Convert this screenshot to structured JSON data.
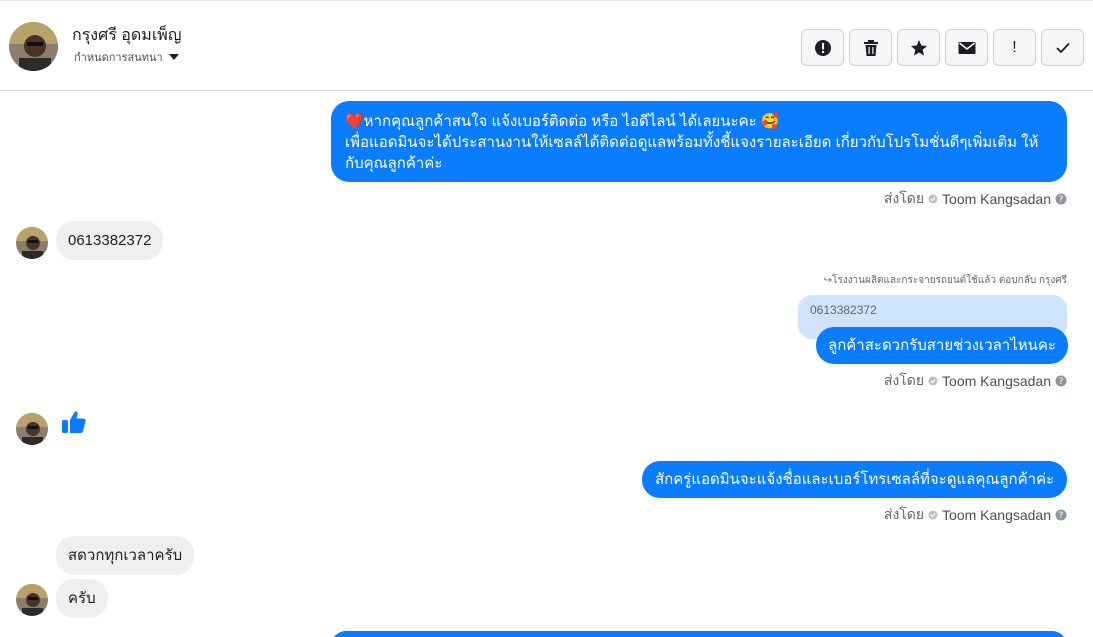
{
  "header": {
    "contact_name": "กรุงศรี อุดมเพ็ญ",
    "assign_label": "กำหนดการสนทนา",
    "actions": [
      {
        "icon": "alert-circle-icon"
      },
      {
        "icon": "trash-icon"
      },
      {
        "icon": "star-icon"
      },
      {
        "icon": "envelope-icon"
      },
      {
        "text": "!"
      },
      {
        "icon": "check-icon"
      }
    ]
  },
  "messages": [
    {
      "direction": "out",
      "lines": [
        "❤️หากคุณลูกค้าสนใจ แจ้งเบอร์ติดต่อ หรือ ไอดีไลน์ ได้เลยนะคะ 🥰",
        "เพื่อแอดมินจะได้ประสานงานให้เซลล์ได้ติดต่อดูแลพร้อมทั้งชี้แจงรายละเอียด เกี่ยวกับโปรโมชั่นดีๆเพิ่มเติม ให้กับคุณลูกค้าค่ะ"
      ],
      "sent_by_prefix": "ส่งโดย",
      "sent_by_name": "Toom Kangsadan"
    },
    {
      "direction": "in",
      "text": "0613382372"
    },
    {
      "direction": "out",
      "reply_note": "โรงงานผลิตและกระจายรถยนต์ใช้แล้ว ตอบกลับ กรุงศรี",
      "quoted": "0613382372",
      "text": "ลูกค้าสะดวกรับสายช่วงเวลาไหนคะ",
      "sent_by_prefix": "ส่งโดย",
      "sent_by_name": "Toom Kangsadan"
    },
    {
      "direction": "in",
      "type": "like",
      "icon": "thumbs-up-icon"
    },
    {
      "direction": "out",
      "text": "สักครู่แอดมินจะแจ้งชื่อและเบอร์โทรเซลล์ที่จะดูแลคุณลูกค้าค่ะ",
      "sent_by_prefix": "ส่งโดย",
      "sent_by_name": "Toom Kangsadan"
    },
    {
      "direction": "in",
      "text": "สดวกทุกเวลาครับ"
    },
    {
      "direction": "in",
      "text": "ครับ"
    }
  ],
  "colors": {
    "outgoing_bubble": "#0a7cff",
    "incoming_bubble": "#efefef",
    "quoted_bubble": "#cfe3fd",
    "like": "#0a7cff"
  }
}
